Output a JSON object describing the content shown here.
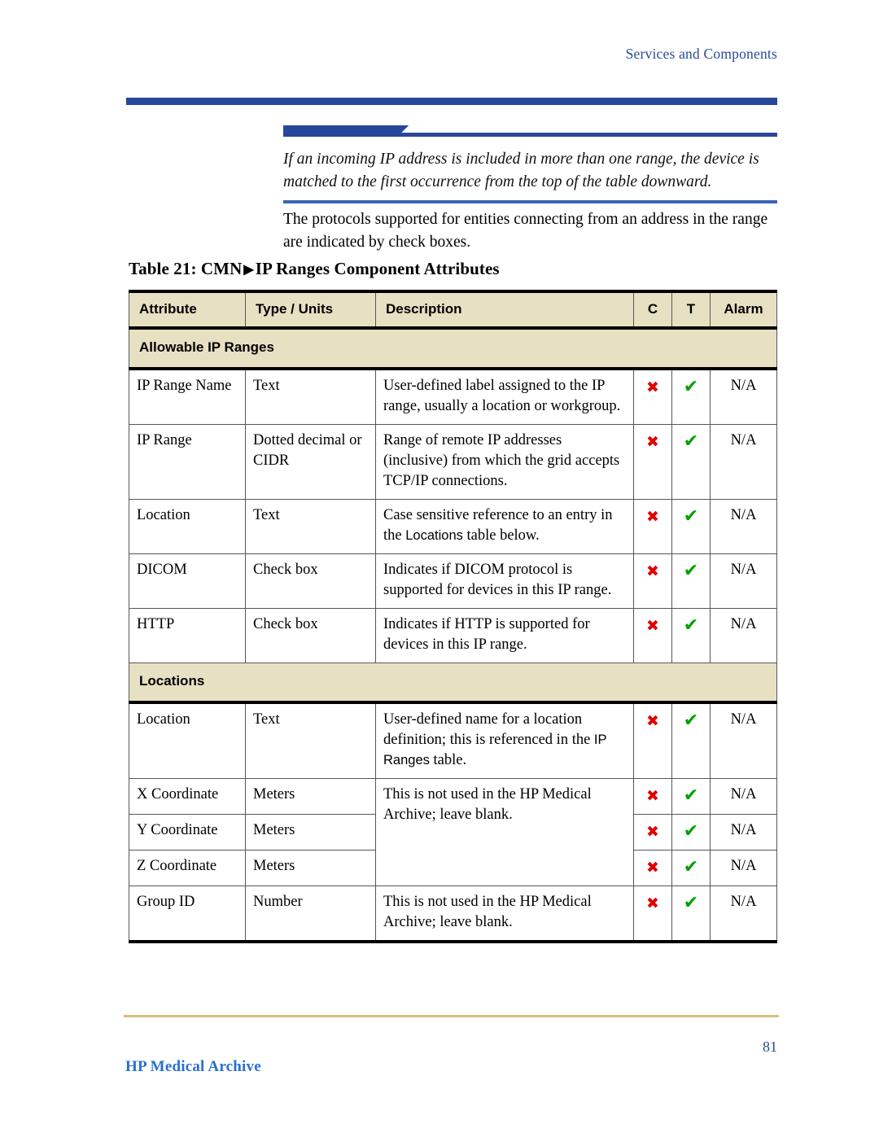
{
  "header": {
    "running_head": "Services and Components"
  },
  "note": {
    "text": "If an incoming IP address is included in more than one range, the device is matched to the first occurrence from the top of the table downward."
  },
  "body": {
    "paragraph": "The protocols supported for entities connecting from an address in the range are indicated by check boxes."
  },
  "table": {
    "caption_prefix": "Table 21: CMN",
    "caption_triangle": "▶",
    "caption_suffix": "IP Ranges Component Attributes",
    "columns": [
      {
        "label": "Attribute"
      },
      {
        "label": "Type / Units"
      },
      {
        "label": "Description"
      },
      {
        "label": "C"
      },
      {
        "label": "T"
      },
      {
        "label": "Alarm"
      }
    ],
    "sections": [
      {
        "title": "Allowable IP Ranges",
        "rows": [
          {
            "attribute": "IP Range Name",
            "type": "Text",
            "description": "User-defined label assigned to the IP range, usually a location or workgroup.",
            "c": "✖",
            "t": "✔",
            "alarm": "N/A"
          },
          {
            "attribute": "IP Range",
            "type": "Dotted decimal or CIDR",
            "description": "Range of remote IP addresses (inclusive) from which the grid accepts TCP/IP connections.",
            "c": "✖",
            "t": "✔",
            "alarm": "N/A"
          },
          {
            "attribute": "Location",
            "type": "Text",
            "description_pre": "Case sensitive reference to an entry in the ",
            "description_term": "Locations",
            "description_post": " table below.",
            "c": "✖",
            "t": "✔",
            "alarm": "N/A"
          },
          {
            "attribute": "DICOM",
            "type": "Check box",
            "description": "Indicates if DICOM protocol is supported for devices in this IP range.",
            "c": "✖",
            "t": "✔",
            "alarm": "N/A"
          },
          {
            "attribute": "HTTP",
            "type": "Check box",
            "description": "Indicates if HTTP is supported for devices in this IP range.",
            "c": "✖",
            "t": "✔",
            "alarm": "N/A"
          }
        ]
      },
      {
        "title": "Locations",
        "rows": [
          {
            "attribute": "Location",
            "type": "Text",
            "description_pre": "User-defined name for a location definition; this is referenced in the ",
            "description_term": "IP Ranges",
            "description_post": " table.",
            "c": "✖",
            "t": "✔",
            "alarm": "N/A"
          },
          {
            "attribute": "X Coordinate",
            "type": "Meters",
            "description": "This is not used in the HP Medical Archive; leave blank.",
            "description_rowspan": 3,
            "c": "✖",
            "t": "✔",
            "alarm": "N/A"
          },
          {
            "attribute": "Y Coordinate",
            "type": "Meters",
            "c": "✖",
            "t": "✔",
            "alarm": "N/A"
          },
          {
            "attribute": "Z Coordinate",
            "type": "Meters",
            "c": "✖",
            "t": "✔",
            "alarm": "N/A"
          },
          {
            "attribute": "Group ID",
            "type": "Number",
            "description": "This is not used in the HP Medical Archive; leave blank.",
            "c": "✖",
            "t": "✔",
            "alarm": "N/A"
          }
        ]
      }
    ]
  },
  "footer": {
    "page_number": "81",
    "document_title": "HP Medical Archive"
  },
  "colors": {
    "rule_blue": "#27479a",
    "header_blue": "#2a4b9b",
    "table_header_bg": "#e8e0c3",
    "mark_red": "#e00000",
    "mark_green": "#00a000",
    "footer_rule": "#d9bf7e"
  }
}
